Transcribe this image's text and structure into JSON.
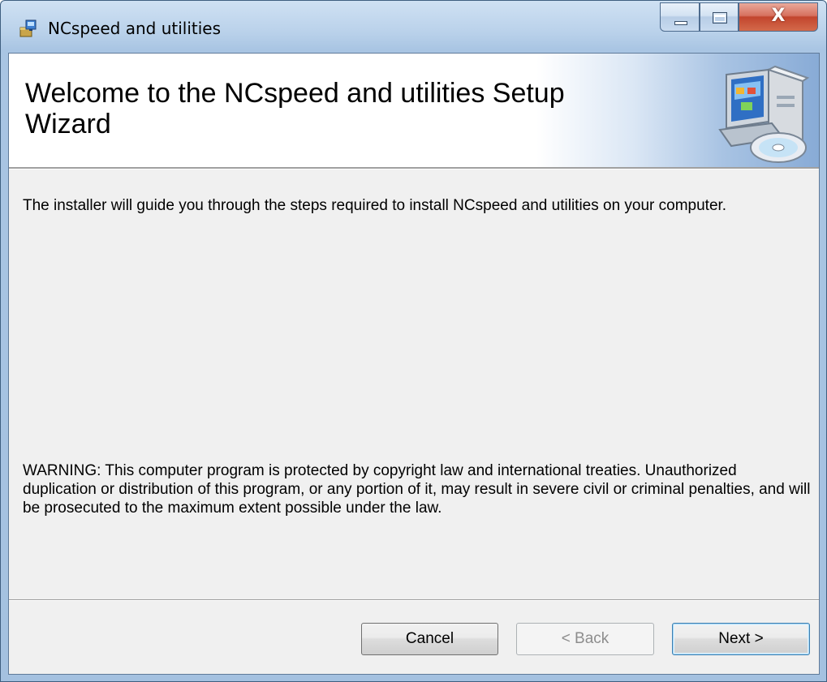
{
  "window": {
    "title": "NCspeed and utilities",
    "icon": "installer-package-icon",
    "controls": {
      "minimize_icon": "minimize-icon",
      "maximize_icon": "maximize-icon",
      "close_glyph": "X",
      "close_color": "#c2452d"
    }
  },
  "banner": {
    "title": "Welcome to the NCspeed and utilities Setup Wizard",
    "art_icon": "computer-setup-icon"
  },
  "body": {
    "intro": "The installer will guide you through the steps required to install NCspeed and utilities on your computer.",
    "warning": "WARNING: This computer program is protected by copyright law and international treaties. Unauthorized duplication or distribution of this program, or any portion of it, may result in severe civil or criminal penalties, and will be prosecuted to the maximum extent possible under the law."
  },
  "buttons": {
    "cancel": "Cancel",
    "back": "< Back",
    "next": "Next >",
    "back_enabled": false,
    "default_button": "next"
  }
}
